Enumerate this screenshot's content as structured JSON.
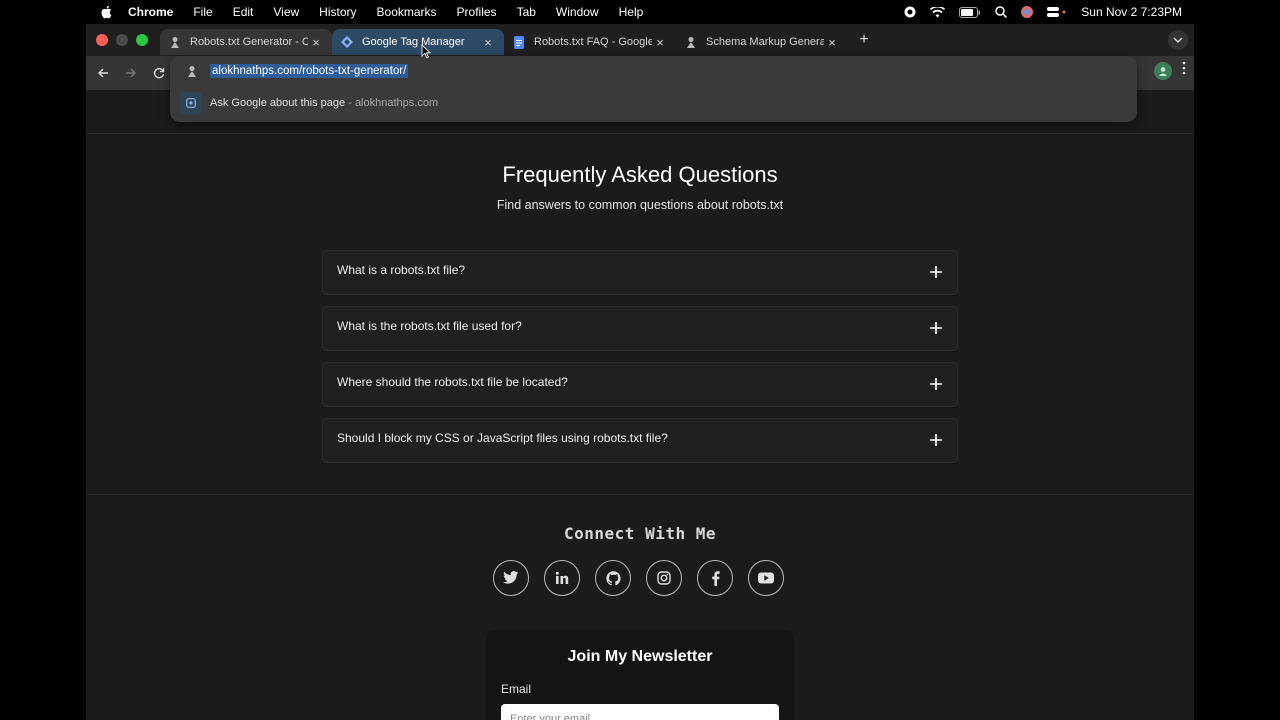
{
  "menubar": {
    "app": "Chrome",
    "items": [
      "File",
      "Edit",
      "View",
      "History",
      "Bookmarks",
      "Profiles",
      "Tab",
      "Window",
      "Help"
    ],
    "clock": "Sun Nov 2  7:23PM"
  },
  "tabs": [
    {
      "title": "Robots.txt Generator - Create",
      "icon": "person-favicon"
    },
    {
      "title": "Google Tag Manager",
      "icon": "tag-manager-favicon"
    },
    {
      "title": "Robots.txt FAQ - Google Docs",
      "icon": "docs-favicon"
    },
    {
      "title": "Schema Markup Generator - S",
      "icon": "person-favicon"
    }
  ],
  "omnibox": {
    "url": "alokhnathps.com/robots-txt-generator/",
    "suggestion_main": "Ask Google about this page",
    "suggestion_sep": " - ",
    "suggestion_site": "alokhnathps.com"
  },
  "faq": {
    "title": "Frequently Asked Questions",
    "subtitle": "Find answers to common questions about robots.txt",
    "items": [
      {
        "question": "What is a robots.txt file?"
      },
      {
        "question": "What is the robots.txt file used for?"
      },
      {
        "question": "Where should the robots.txt file be located?"
      },
      {
        "question": "Should I block my CSS or JavaScript files using robots.txt file?"
      }
    ]
  },
  "connect": {
    "title": "Connect With Me",
    "socials": [
      "twitter-icon",
      "linkedin-icon",
      "github-icon",
      "instagram-icon",
      "facebook-icon",
      "youtube-icon"
    ]
  },
  "newsletter": {
    "title": "Join My Newsletter",
    "email_label": "Email",
    "email_placeholder": "Enter your email"
  },
  "colors": {
    "tab_hover": "#2c4a66",
    "url_selection": "#2e5d9a",
    "page_bg": "#1b1b1b"
  }
}
